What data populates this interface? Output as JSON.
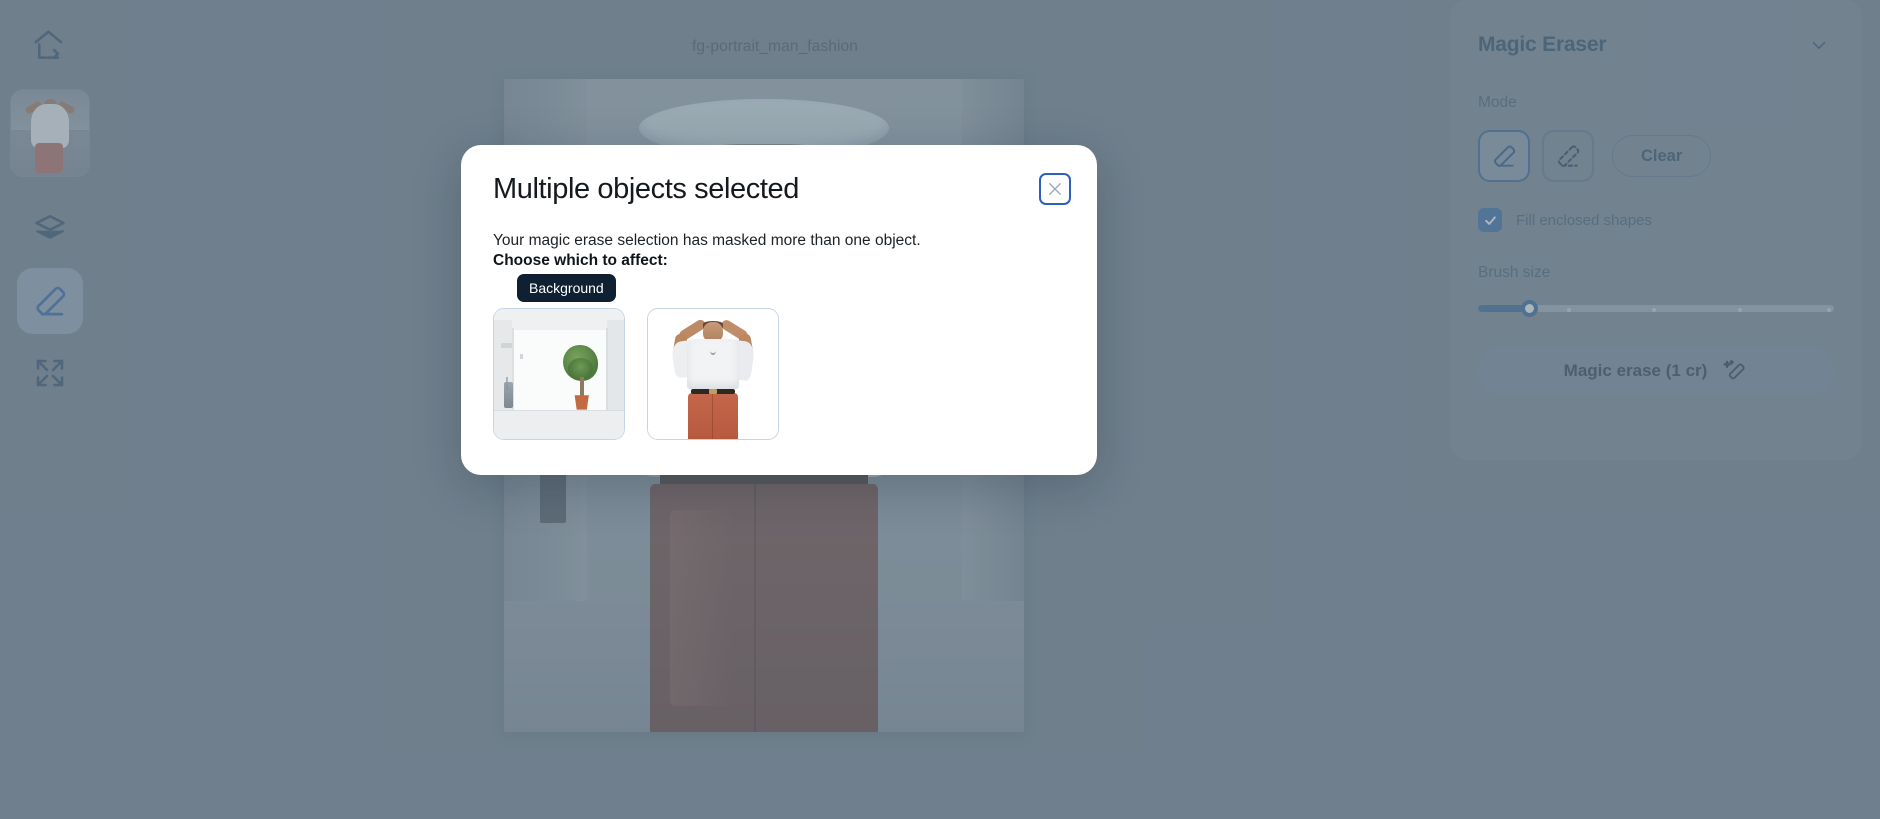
{
  "app": {
    "backdrop_color": "#6f7f8d",
    "canvas_title": "fg-portrait_man_fashion"
  },
  "sidebar": {
    "items": [
      {
        "label": "Home",
        "icon": "home-exit-icon",
        "active": false
      },
      {
        "label": "Project thumbnail",
        "icon": "project-thumbnail",
        "active": false
      },
      {
        "label": "Layers",
        "icon": "layers-icon",
        "active": false
      },
      {
        "label": "Magic Eraser",
        "icon": "eraser-icon",
        "active": true
      },
      {
        "label": "Fit to screen",
        "icon": "expand-arrows-icon",
        "active": false
      }
    ]
  },
  "right_panel": {
    "title": "Magic Eraser",
    "collapse_icon": "chevron-down-icon",
    "mode_label": "Mode",
    "modes": [
      {
        "name": "eraser-solid",
        "icon": "eraser-icon",
        "selected": true
      },
      {
        "name": "eraser-dashed",
        "icon": "eraser-dashed-icon",
        "selected": false
      }
    ],
    "clear_label": "Clear",
    "fill_checkbox": {
      "label": "Fill enclosed shapes",
      "checked": true
    },
    "brush_size": {
      "label": "Brush size",
      "value_percent": 13,
      "ticks": [
        25,
        50,
        75,
        100
      ]
    },
    "primary_button": {
      "label": "Magic erase (1 cr)",
      "icon": "magic-eraser-sparkle-icon"
    },
    "accent_color": "#2b5f96"
  },
  "modal": {
    "title": "Multiple objects selected",
    "close_icon": "close-icon",
    "body_text": "Your magic erase selection has masked more than one object.",
    "prompt": "Choose which to affect:",
    "tooltip": "Background",
    "options": [
      {
        "name": "background-thumbnail",
        "alt": "Empty white studio room with potted tree"
      },
      {
        "name": "foreground-thumbnail",
        "alt": "Man in white shirt and orange trousers cutout"
      }
    ]
  }
}
